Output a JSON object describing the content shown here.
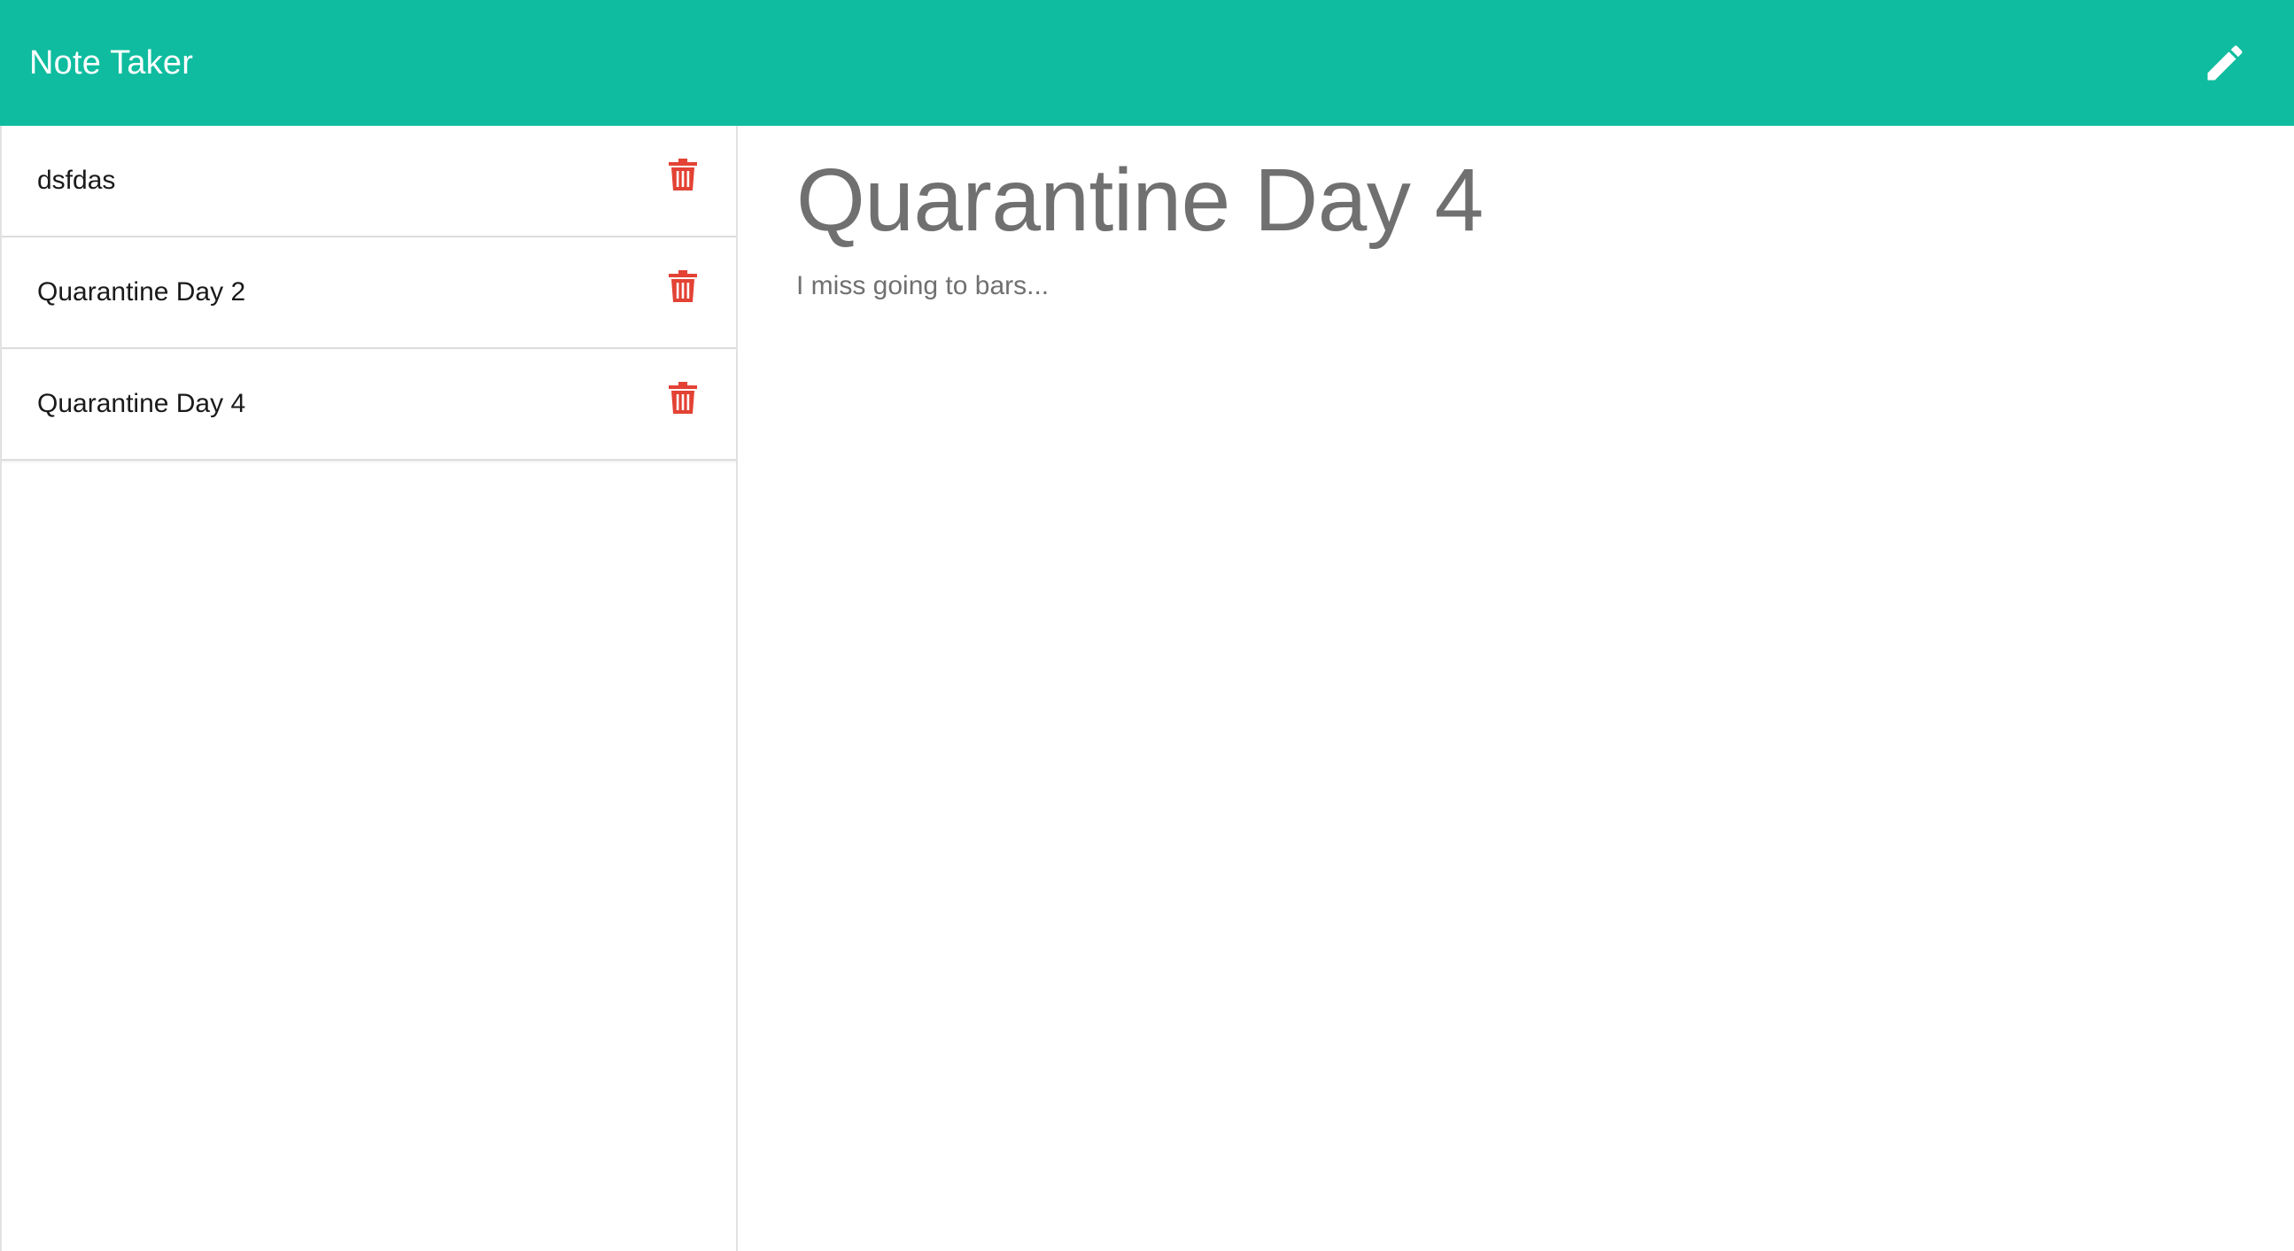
{
  "header": {
    "brand": "Note Taker",
    "new_note_icon": "pencil-icon",
    "bg_color": "#0fbc9f"
  },
  "sidebar": {
    "notes": [
      {
        "title": "dsfdas",
        "delete_icon": "trash-icon"
      },
      {
        "title": "Quarantine Day 2",
        "delete_icon": "trash-icon"
      },
      {
        "title": "Quarantine Day 4",
        "delete_icon": "trash-icon"
      }
    ],
    "delete_color": "#e34234"
  },
  "main": {
    "title": "Quarantine Day 4",
    "body": "I miss going to bars..."
  }
}
